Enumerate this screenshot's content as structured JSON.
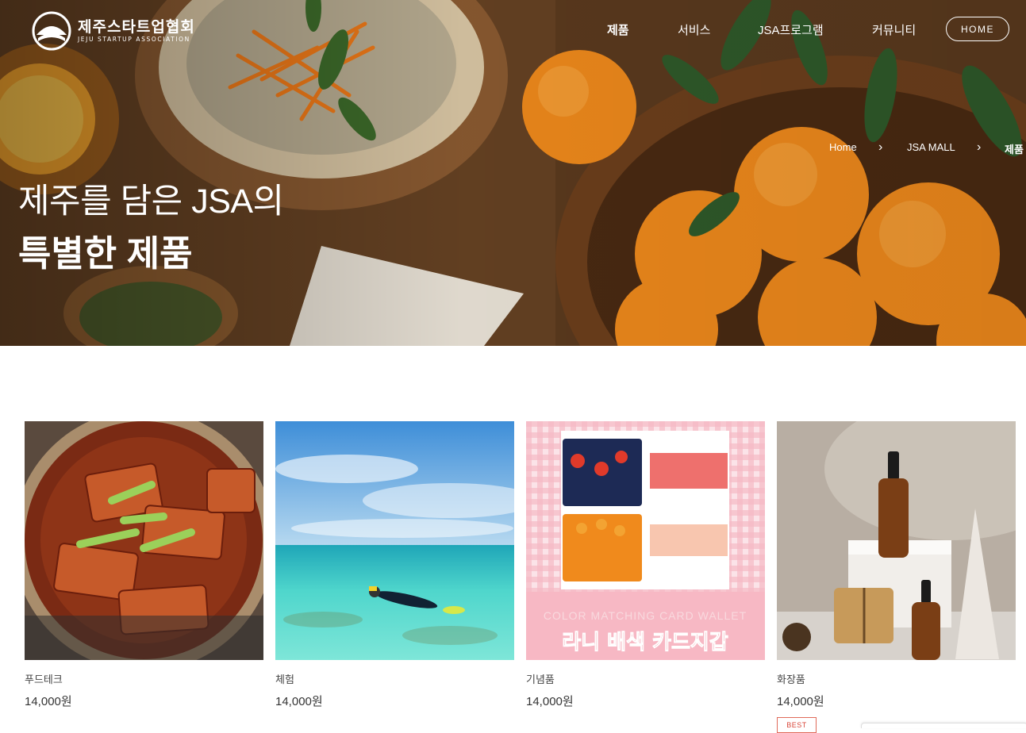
{
  "brand": {
    "name_ko": "제주스타트업협회",
    "name_en": "JEJU STARTUP ASSOCIATION"
  },
  "nav": {
    "items": [
      {
        "label": "제품",
        "active": true
      },
      {
        "label": "서비스",
        "active": false
      },
      {
        "label": "JSA프로그램",
        "active": false
      },
      {
        "label": "커뮤니티",
        "active": false
      }
    ],
    "home_button": "HOME"
  },
  "breadcrumb": [
    "Home",
    "JSA MALL",
    "제품"
  ],
  "hero": {
    "line1": "제주를 담은 JSA의",
    "line2": "특별한 제품"
  },
  "products": [
    {
      "category": "푸드테크",
      "price": "14,000원",
      "image": "spicy-braised-tofu-stew"
    },
    {
      "category": "체험",
      "price": "14,000원",
      "image": "snorkeling-sea"
    },
    {
      "category": "기념품",
      "price": "14,000원",
      "image": "color-matching-card-wallet",
      "image_caption_en": "COLOR MATCHING CARD WALLET",
      "image_caption_ko": "라니 배색 카드지갑"
    },
    {
      "category": "화장품",
      "price": "14,000원",
      "image": "cosmetic-oil-bottles",
      "badge": "BEST"
    }
  ],
  "colors": {
    "accent_badge": "#d9473a",
    "orange": "#f08a1c",
    "sea": "#4fd6cc",
    "pink": "#f7b8c4"
  }
}
